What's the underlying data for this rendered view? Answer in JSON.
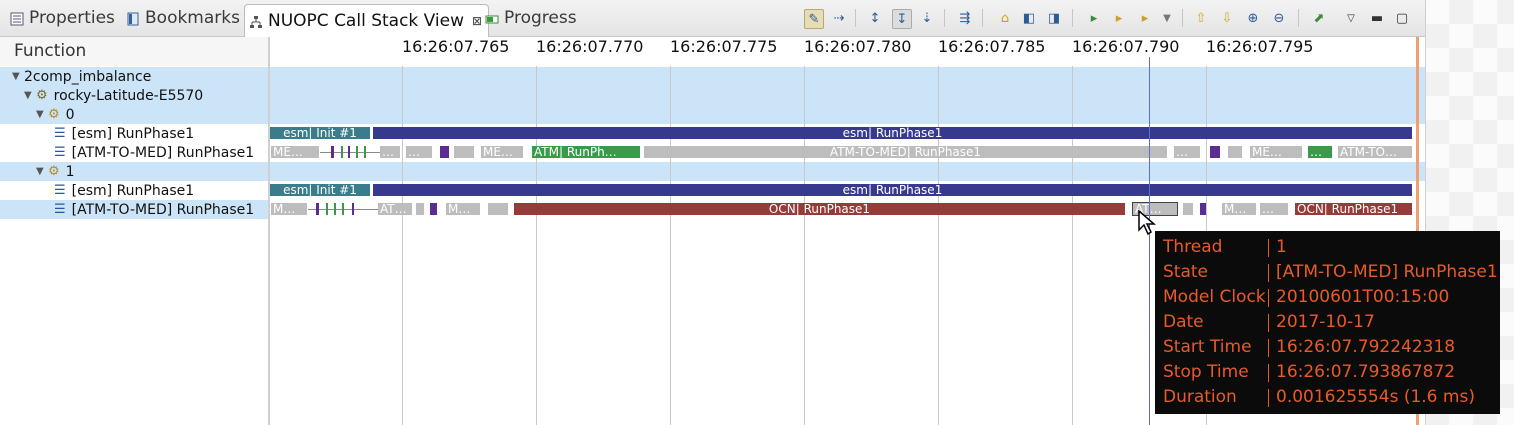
{
  "tabs": [
    {
      "label": "Properties",
      "icon": "properties-icon"
    },
    {
      "label": "Bookmarks",
      "icon": "bookmarks-icon"
    },
    {
      "label": "NUOPC Call Stack View",
      "icon": "call-stack-icon",
      "active": true
    },
    {
      "label": "Progress",
      "icon": "progress-icon"
    }
  ],
  "toolbar_icons": [
    "pin-icon",
    "align-views-icon",
    "sort-name-icon",
    "sort-id-icon",
    "sort-time-icon",
    "filter-icon",
    "home-icon",
    "previous-event-icon",
    "next-event-icon",
    "add-bookmark-icon",
    "previous-marker-icon",
    "next-marker-icon",
    "dropdown-icon",
    "previous-item-icon",
    "next-item-icon",
    "zoom-in-icon",
    "zoom-out-icon",
    "export-icon",
    "view-menu-icon",
    "minimize-icon",
    "maximize-icon"
  ],
  "function_header": "Function",
  "tree": [
    {
      "label": "2comp_imbalance",
      "level": 0,
      "icon": "trace-icon"
    },
    {
      "label": "rocky-Latitude-E5570",
      "level": 1,
      "icon": "host-icon"
    },
    {
      "label": "0",
      "level": 2,
      "icon": "process-icon"
    },
    {
      "label": "[esm] RunPhase1",
      "level": 3,
      "icon": "thread-icon"
    },
    {
      "label": "[ATM-TO-MED] RunPhase1",
      "level": 3,
      "icon": "thread-icon"
    },
    {
      "label": "1",
      "level": 2,
      "icon": "process-icon"
    },
    {
      "label": "[esm] RunPhase1",
      "level": 3,
      "icon": "thread-icon"
    },
    {
      "label": "[ATM-TO-MED] RunPhase1",
      "level": 3,
      "icon": "thread-icon"
    }
  ],
  "time_ticks": [
    "16:26:07.765",
    "16:26:07.770",
    "16:26:07.775",
    "16:26:07.780",
    "16:26:07.785",
    "16:26:07.790",
    "16:26:07.795"
  ],
  "labels": {
    "esm_init": "esm| Init #1",
    "esm_run": "esm| RunPhase1",
    "me": "ME…",
    "me2": "ME…",
    "m": "M…",
    "at": "AT…",
    "ell": "…",
    "atm_run": "ATM| RunPh…",
    "atm_to_med": "ATM-TO-MED| RunPhase1",
    "atm_to": "ATM-TO…",
    "ocn_run": "OCN| RunPhase1",
    "ocn_run2": "OCN| RunPhase1"
  },
  "colors": {
    "esm": "#37398e",
    "init": "#3a7c8c",
    "grey": "#bdbdbd",
    "green": "#3a9a4a",
    "purple": "#5c2d91",
    "red": "#973a3a",
    "selection": "#cce4f7",
    "tooltip_text": "#e85a28"
  },
  "tooltip": [
    {
      "key": "Thread",
      "value": "1"
    },
    {
      "key": "State",
      "value": "[ATM-TO-MED] RunPhase1"
    },
    {
      "key": "Model Clock",
      "value": "20100601T00:15:00"
    },
    {
      "key": "Date",
      "value": "2017-10-17"
    },
    {
      "key": "Start Time",
      "value": "16:26:07.792242318"
    },
    {
      "key": "Stop Time",
      "value": "16:26:07.793867872"
    },
    {
      "key": "Duration",
      "value": "0.001625554s (1.6 ms)"
    }
  ]
}
